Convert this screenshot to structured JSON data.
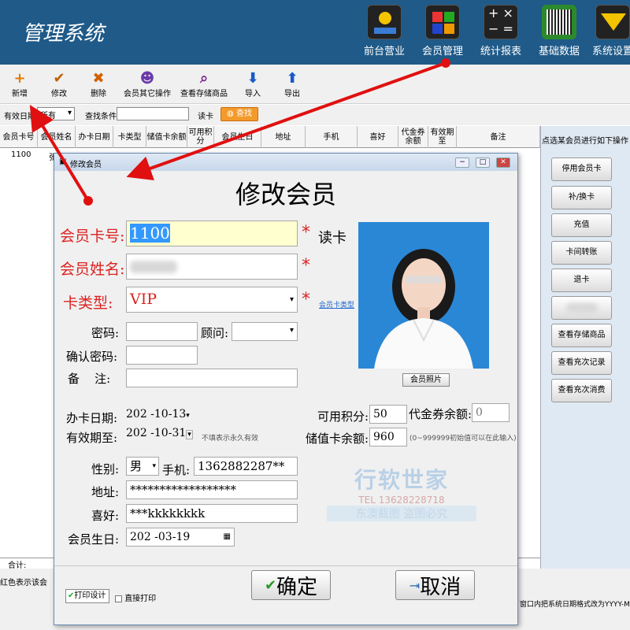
{
  "app": {
    "title": "管理系统"
  },
  "modules": [
    {
      "label": "前台营业",
      "icon": "cashier-icon"
    },
    {
      "label": "会员管理",
      "icon": "member-icon"
    },
    {
      "label": "统计报表",
      "icon": "calculator-icon"
    },
    {
      "label": "基础数据",
      "icon": "barcode-icon"
    },
    {
      "label": "系统设置",
      "icon": "settings-icon"
    }
  ],
  "toolbar": {
    "add": "新增",
    "edit": "修改",
    "delete": "删除",
    "other": "会员其它操作",
    "stored": "查看存储商品",
    "import": "导入",
    "export": "导出"
  },
  "filter": {
    "expiry_label": "有效日期",
    "expiry_value": "所有",
    "search_label": "查找条件",
    "search_value": "",
    "read_card": "读卡",
    "search_button": "查找"
  },
  "grid": {
    "columns": [
      "会员卡号",
      "会员姓名",
      "办卡日期",
      "卡类型",
      "储值卡余额",
      "可用积分",
      "会员生日",
      "地址",
      "手机",
      "喜好",
      "代金券余额",
      "有效期至",
      "备注"
    ],
    "rows": [
      {
        "card": "1100",
        "name": "张"
      }
    ],
    "total_label": "合计:"
  },
  "right_panel": {
    "title": "点选某会员进行如下操作",
    "buttons": [
      "停用会员卡",
      "补/换卡",
      "充值",
      "卡间转账",
      "退卡",
      "",
      "查看存储商品",
      "查看充次记录",
      "查看充次消费"
    ]
  },
  "status": {
    "left": "红色表示该会",
    "right": "窗口内把系统日期格式改为YYYY-MM"
  },
  "dialog": {
    "window_title": "修改会员",
    "heading": "修改会员",
    "card_no_label": "会员卡号:",
    "card_no": "1100",
    "read_card": "读卡",
    "name_label": "会员姓名:",
    "card_type_label": "卡类型:",
    "card_type": "VIP",
    "card_type_link": "会员卡类型",
    "password_label": "密码:",
    "consultant_label": "顾问:",
    "confirm_password_label": "确认密码:",
    "notes_label": "备    注:",
    "issue_date_label": "办卡日期:",
    "issue_date": "202 -10-13",
    "expiry_label": "有效期至:",
    "expiry_date": "202 -10-31",
    "expiry_hint": "不填表示永久有效",
    "points_label": "可用积分:",
    "points": "50",
    "voucher_label": "代金券余额:",
    "voucher": "0",
    "stored_label": "储值卡余额:",
    "stored": "960",
    "stored_hint": "(0~999999初始值可以在此输入)",
    "gender_label": "性别:",
    "gender": "男",
    "phone_label": "手机:",
    "phone": "1362882287**",
    "address_label": "地址:",
    "address": "******************",
    "hobby_label": "喜好:",
    "hobby": "***kkkkkkkk",
    "birthday_label": "会员生日:",
    "birthday": "202 -03-19",
    "photo_button": "会员照片",
    "print_design": "打印设计",
    "direct_print": "直接打印",
    "ok": "确定",
    "cancel": "取消"
  },
  "watermark": {
    "line1": "行软世家",
    "line2": "TEL  13628228718",
    "line3": "东澳截图  盗图必究"
  }
}
